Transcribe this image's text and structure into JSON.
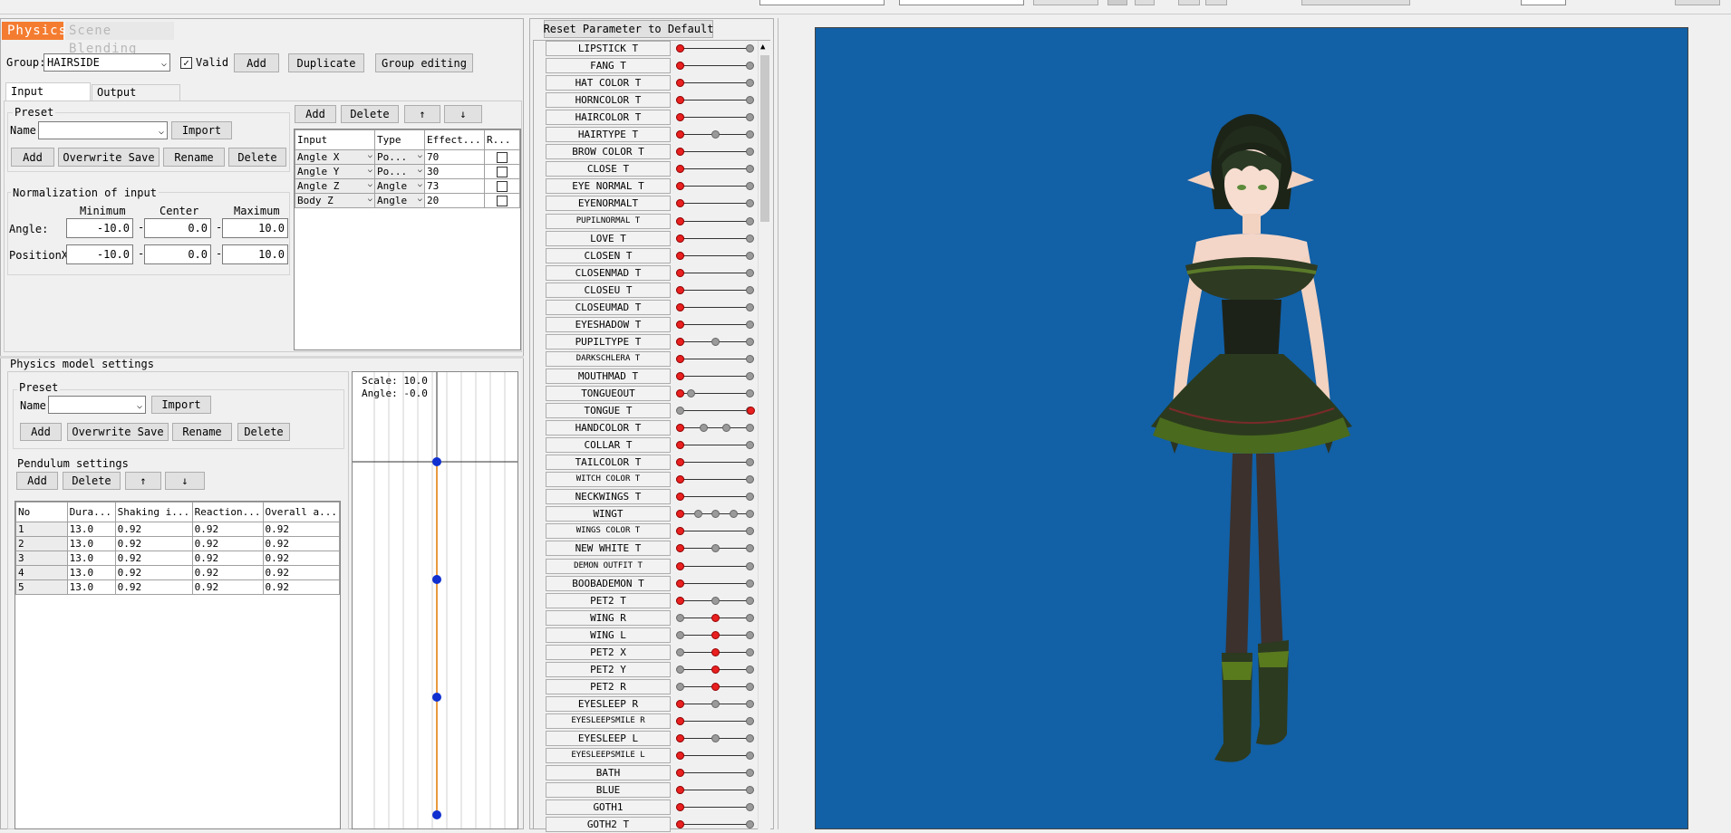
{
  "top_tabs": [
    {
      "label": "Physics"
    },
    {
      "label": "Scene Blending"
    }
  ],
  "group": {
    "label": "Group:",
    "value": "HAIRSIDE",
    "valid_label": "Valid",
    "valid_checked": true,
    "add": "Add",
    "duplicate": "Duplicate",
    "group_editing": "Group editing"
  },
  "sub_tabs": [
    {
      "label": "Input settings"
    },
    {
      "label": "Output Settings"
    }
  ],
  "preset": {
    "title": "Preset",
    "name_label": "Name:",
    "name_value": "",
    "import": "Import",
    "add": "Add",
    "overwrite": "Overwrite Save",
    "rename": "Rename",
    "delete": "Delete"
  },
  "normalization": {
    "title": "Normalization of input",
    "headers": [
      "Minimum",
      "Center",
      "Maximum"
    ],
    "rows": [
      {
        "label": "Angle:",
        "min": "-10.0",
        "center": "0.0",
        "max": "10.0"
      },
      {
        "label": "PositionX:",
        "min": "-10.0",
        "center": "0.0",
        "max": "10.0"
      }
    ]
  },
  "input_toolbar": {
    "add": "Add",
    "delete": "Delete",
    "up": "↑",
    "down": "↓"
  },
  "input_table": {
    "headers": [
      "Input",
      "Type",
      "Effect...",
      "R..."
    ],
    "rows": [
      {
        "input": "Angle X",
        "type": "Po...",
        "effect": "70"
      },
      {
        "input": "Angle Y",
        "type": "Po...",
        "effect": "30"
      },
      {
        "input": "Angle Z",
        "type": "Angle",
        "effect": "73"
      },
      {
        "input": "Body Z",
        "type": "Angle",
        "effect": "20"
      }
    ]
  },
  "physics_model": {
    "title": "Physics model settings",
    "preset_title": "Preset",
    "name_label": "Name:",
    "import": "Import",
    "add": "Add",
    "overwrite": "Overwrite Save",
    "rename": "Rename",
    "delete": "Delete",
    "pendulum_title": "Pendulum settings",
    "p_add": "Add",
    "p_delete": "Delete",
    "p_up": "↑",
    "p_down": "↓",
    "table_headers": [
      "No",
      "Dura...",
      "Shaking i...",
      "Reaction...",
      "Overall a..."
    ],
    "table_rows": [
      {
        "no": "1",
        "dur": "13.0",
        "shake": "0.92",
        "react": "0.92",
        "overall": "0.92"
      },
      {
        "no": "2",
        "dur": "13.0",
        "shake": "0.92",
        "react": "0.92",
        "overall": "0.92"
      },
      {
        "no": "3",
        "dur": "13.0",
        "shake": "0.92",
        "react": "0.92",
        "overall": "0.92"
      },
      {
        "no": "4",
        "dur": "13.0",
        "shake": "0.92",
        "react": "0.92",
        "overall": "0.92"
      },
      {
        "no": "5",
        "dur": "13.0",
        "shake": "0.92",
        "react": "0.92",
        "overall": "0.92"
      }
    ]
  },
  "preview": {
    "scale": "Scale: 10.0",
    "angle": "Angle: -0.0"
  },
  "reset_button": "Reset Parameter to Default",
  "parameters": [
    {
      "name": "LIPSTICK T",
      "knob": 0,
      "ticks": []
    },
    {
      "name": "FANG T",
      "knob": 0,
      "ticks": []
    },
    {
      "name": "HAT COLOR T",
      "knob": 0,
      "ticks": []
    },
    {
      "name": "HORNCOLOR T",
      "knob": 0,
      "ticks": []
    },
    {
      "name": "HAIRCOLOR T",
      "knob": 0,
      "ticks": []
    },
    {
      "name": "HAIRTYPE T",
      "knob": 0,
      "ticks": [
        0.5
      ]
    },
    {
      "name": "BROW COLOR T",
      "knob": 0,
      "ticks": []
    },
    {
      "name": "CLOSE T",
      "knob": 0,
      "ticks": []
    },
    {
      "name": "EYE NORMAL T",
      "knob": 0,
      "ticks": []
    },
    {
      "name": "EYENORMALT",
      "knob": 0,
      "ticks": []
    },
    {
      "name": "PUPILNORMAL T",
      "knob": 0,
      "ticks": []
    },
    {
      "name": "LOVE T",
      "knob": 0,
      "ticks": []
    },
    {
      "name": "CLOSEN T",
      "knob": 0,
      "ticks": []
    },
    {
      "name": "CLOSENMAD T",
      "knob": 0,
      "ticks": []
    },
    {
      "name": "CLOSEU T",
      "knob": 0,
      "ticks": []
    },
    {
      "name": "CLOSEUMAD T",
      "knob": 0,
      "ticks": []
    },
    {
      "name": "EYESHADOW T",
      "knob": 0,
      "ticks": []
    },
    {
      "name": "PUPILTYPE T",
      "knob": 0,
      "ticks": [
        0.5
      ]
    },
    {
      "name": "DARKSCHLERA T",
      "knob": 0,
      "ticks": []
    },
    {
      "name": "MOUTHMAD T",
      "knob": 0,
      "ticks": []
    },
    {
      "name": "TONGUEOUT",
      "knob": 0,
      "ticks": [
        0.15
      ]
    },
    {
      "name": "TONGUE T",
      "knob": 1,
      "ticks": []
    },
    {
      "name": "HANDCOLOR T",
      "knob": 0,
      "ticks": [
        0.33,
        0.66
      ]
    },
    {
      "name": "COLLAR T",
      "knob": 0,
      "ticks": []
    },
    {
      "name": "TAILCOLOR T",
      "knob": 0,
      "ticks": []
    },
    {
      "name": "WITCH COLOR T",
      "knob": 0,
      "ticks": []
    },
    {
      "name": "NECKWINGS T",
      "knob": 0,
      "ticks": []
    },
    {
      "name": "WINGT",
      "knob": 0,
      "ticks": [
        0.25,
        0.5,
        0.75
      ]
    },
    {
      "name": "WINGS COLOR T",
      "knob": 0,
      "ticks": []
    },
    {
      "name": "NEW WHITE T",
      "knob": 0,
      "ticks": [
        0.5
      ]
    },
    {
      "name": "DEMON OUTFIT T",
      "knob": 0,
      "ticks": []
    },
    {
      "name": "BOOBADEMON T",
      "knob": 0,
      "ticks": []
    },
    {
      "name": "PET2 T",
      "knob": 0,
      "ticks": [
        0.5
      ]
    },
    {
      "name": "WING R",
      "knob": 0.5,
      "ticks": []
    },
    {
      "name": "WING L",
      "knob": 0.5,
      "ticks": []
    },
    {
      "name": "PET2 X",
      "knob": 0.5,
      "ticks": []
    },
    {
      "name": "PET2 Y",
      "knob": 0.5,
      "ticks": []
    },
    {
      "name": "PET2 R",
      "knob": 0.5,
      "ticks": []
    },
    {
      "name": "EYESLEEP R",
      "knob": 0,
      "ticks": [
        0.5
      ]
    },
    {
      "name": "EYESLEEPSMILE R",
      "knob": 0,
      "ticks": []
    },
    {
      "name": "EYESLEEP L",
      "knob": 0,
      "ticks": [
        0.5
      ]
    },
    {
      "name": "EYESLEEPSMILE L",
      "knob": 0,
      "ticks": []
    },
    {
      "name": "BATH",
      "knob": 0,
      "ticks": []
    },
    {
      "name": "BLUE",
      "knob": 0,
      "ticks": []
    },
    {
      "name": "GOTH1",
      "knob": 0,
      "ticks": []
    },
    {
      "name": "GOTH2 T",
      "knob": 0,
      "ticks": []
    }
  ],
  "colors": {
    "active_tab": "#f47c30",
    "viewport_bg": "#1260a6",
    "knob": "#e82020",
    "pendulum_line": "#e89a40",
    "pendulum_dot": "#1030d0"
  }
}
